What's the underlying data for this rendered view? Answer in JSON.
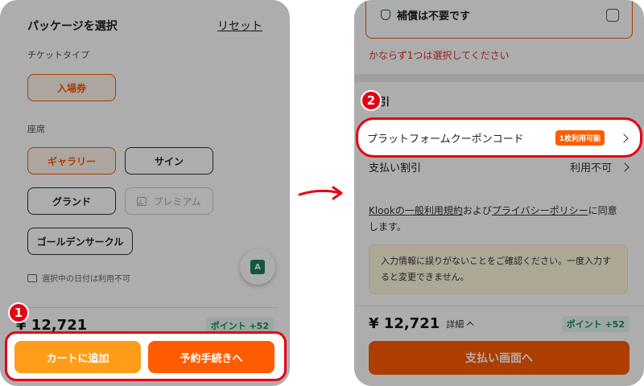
{
  "left_screen": {
    "header": {
      "title": "パッケージを選択",
      "reset": "リセット"
    },
    "ticket_type": {
      "label": "チケットタイプ",
      "options": [
        "入場券"
      ],
      "selected": "入場券"
    },
    "seats": {
      "label": "座席",
      "options": [
        {
          "label": "ギャラリー",
          "state": "selected"
        },
        {
          "label": "サイン",
          "state": "normal"
        },
        {
          "label": "グランド",
          "state": "normal"
        },
        {
          "label": "プレミアム",
          "state": "disabled"
        },
        {
          "label": "ゴールデンサークル",
          "state": "normal"
        }
      ]
    },
    "unavailable_note": "選択中の日付は利用不可",
    "translate_fab_icon": "translate-icon",
    "footer": {
      "price": "¥ 12,721",
      "points": "ポイント +52",
      "cart_button": "カートに追加",
      "book_button": "予約手続きへ"
    }
  },
  "right_screen": {
    "insurance": {
      "label": "補償は不要です",
      "error": "かならず1つは選択してください"
    },
    "discount": {
      "title": "割引",
      "coupon_row": {
        "label": "プラットフォームクーポンコード",
        "badge": "1枚利用可能"
      },
      "payment_row": {
        "label": "支払い割引",
        "value": "利用不可"
      }
    },
    "terms": {
      "link1": "Klookの一般利用規約",
      "mid": "および",
      "link2": "プライバシーポリシー",
      "tail": "に同意します。"
    },
    "notice": "入力情報に誤りがないことをご確認ください。一度入力すると変更できません。",
    "footer": {
      "price": "¥ 12,721",
      "details": "詳細",
      "points": "ポイント +52",
      "pay_button": "支払い画面へ"
    }
  },
  "annotations": {
    "step1": "1",
    "step2": "2",
    "highlight_color": "#e60012"
  },
  "colors": {
    "brand_orange": "#ff5b00",
    "cart_orange": "#ff9d1a",
    "error_red": "#e0312d",
    "points_green": "#1b8a5a"
  }
}
